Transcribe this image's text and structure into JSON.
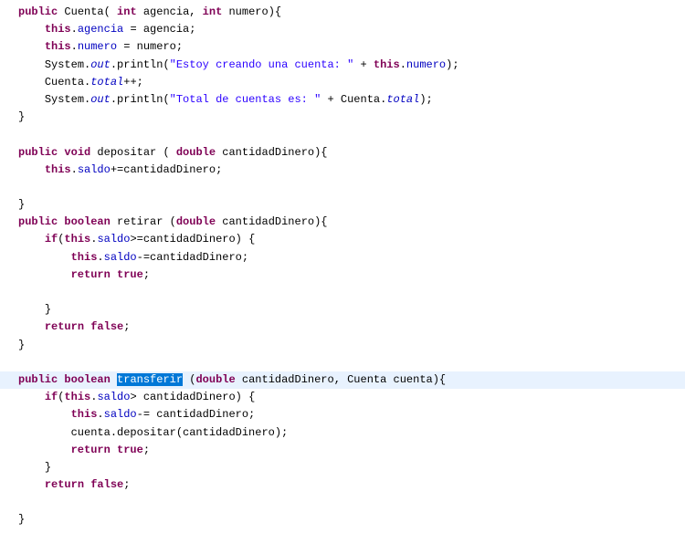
{
  "code": {
    "l1": {
      "kw1": "public",
      "name": "Cuenta",
      "open": "( ",
      "kw2": "int",
      "p1": " agencia, ",
      "kw3": "int",
      "p2": " numero){"
    },
    "l2": {
      "pre": "    ",
      "kw": "this",
      "rest": ".",
      "field": "agencia",
      "assign": " = agencia;"
    },
    "l3": {
      "pre": "    ",
      "kw": "this",
      "rest": ".",
      "field": "numero",
      "assign": " = numero;"
    },
    "l4": {
      "pre": "    ",
      "sys": "System.",
      "out": "out",
      "dot": ".println(",
      "str": "\"Estoy creando una cuenta: \"",
      "plus": " + ",
      "kw": "this",
      "dot2": ".",
      "field": "numero",
      "end": ");"
    },
    "l5": {
      "pre": "    ",
      "cls": "Cuenta.",
      "field": "total",
      "end": "++;"
    },
    "l6": {
      "pre": "    ",
      "sys": "System.",
      "out": "out",
      "dot": ".println(",
      "str": "\"Total de cuentas es: \"",
      "plus": " + Cuenta.",
      "field": "total",
      "end": ");"
    },
    "l7": {
      "text": "}"
    },
    "l8": {
      "text": ""
    },
    "l9": {
      "kw1": "public",
      "sp": " ",
      "kw2": "void",
      "name": " depositar ( ",
      "kw3": "double",
      "p": " cantidadDinero){"
    },
    "l10": {
      "pre": "    ",
      "kw": "this",
      "dot": ".",
      "field": "saldo",
      "rest": "+=cantidadDinero;"
    },
    "l11": {
      "text": ""
    },
    "l12": {
      "text": "}"
    },
    "l13": {
      "kw1": "public",
      "sp": " ",
      "kw2": "boolean",
      "name": " retirar (",
      "kw3": "double",
      "p": " cantidadDinero){"
    },
    "l14": {
      "pre": "    ",
      "kw": "if",
      "open": "(",
      "kw2": "this",
      "dot": ".",
      "field": "saldo",
      "rest": ">=cantidadDinero) {"
    },
    "l15": {
      "pre": "        ",
      "kw": "this",
      "dot": ".",
      "field": "saldo",
      "rest": "-=cantidadDinero;"
    },
    "l16": {
      "pre": "        ",
      "kw": "return",
      "sp": " ",
      "kw2": "true",
      "end": ";"
    },
    "l17": {
      "text": ""
    },
    "l18": {
      "pre": "    ",
      "text": "}"
    },
    "l19": {
      "pre": "    ",
      "kw": "return",
      "sp": " ",
      "kw2": "false",
      "end": ";"
    },
    "l20": {
      "text": "}"
    },
    "l21": {
      "text": ""
    },
    "l22": {
      "kw1": "public",
      "sp": " ",
      "kw2": "boolean",
      "sp2": " ",
      "sel": "transferir",
      "after": " (",
      "kw3": "double",
      "p1": " cantidadDinero, Cuenta cuenta){"
    },
    "l23": {
      "pre": "    ",
      "kw": "if",
      "open": "(",
      "kw2": "this",
      "dot": ".",
      "field": "saldo",
      "rest": "> cantidadDinero) {"
    },
    "l24": {
      "pre": "        ",
      "kw": "this",
      "dot": ".",
      "field": "saldo",
      "rest": "-= cantidadDinero;"
    },
    "l25": {
      "pre": "        ",
      "obj": "cuenta.depositar(cantidadDinero);"
    },
    "l26": {
      "pre": "        ",
      "kw": "return",
      "sp": " ",
      "kw2": "true",
      "end": ";"
    },
    "l27": {
      "pre": "    ",
      "text": "}"
    },
    "l28": {
      "pre": "    ",
      "kw": "return",
      "sp": " ",
      "kw2": "false",
      "end": ";"
    },
    "l29": {
      "text": ""
    },
    "l30": {
      "text": "}"
    }
  }
}
